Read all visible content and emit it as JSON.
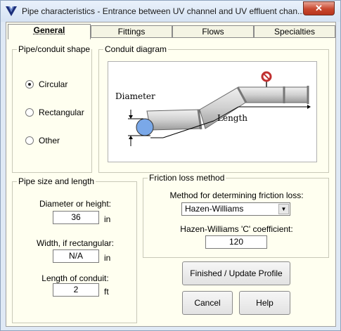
{
  "window": {
    "title": "Pipe characteristics - Entrance between UV channel and UV effluent chan...",
    "close_label": "✕"
  },
  "tabs": [
    {
      "label": "General"
    },
    {
      "label": "Fittings"
    },
    {
      "label": "Flows"
    },
    {
      "label": "Specialties"
    }
  ],
  "shape_group": {
    "title": "Pipe/conduit shape",
    "options": [
      {
        "label": "Circular",
        "checked": true
      },
      {
        "label": "Rectangular",
        "checked": false
      },
      {
        "label": "Other",
        "checked": false
      }
    ]
  },
  "diagram_group": {
    "title": "Conduit diagram",
    "diameter_label": "Diameter",
    "length_label": "Length"
  },
  "size_group": {
    "title": "Pipe size and length",
    "diameter_label": "Diameter or height:",
    "diameter_value": "36",
    "diameter_unit": "in",
    "width_label": "Width, if rectangular:",
    "width_value": "N/A",
    "width_unit": "in",
    "length_label": "Length of conduit:",
    "length_value": "2",
    "length_unit": "ft"
  },
  "friction_group": {
    "title": "Friction loss method",
    "method_label": "Method for determining friction loss:",
    "method_value": "Hazen-Williams",
    "coef_label": "Hazen-Williams 'C' coefficient:",
    "coef_value": "120"
  },
  "buttons": {
    "finish": "Finished / Update Profile",
    "cancel": "Cancel",
    "help": "Help"
  }
}
